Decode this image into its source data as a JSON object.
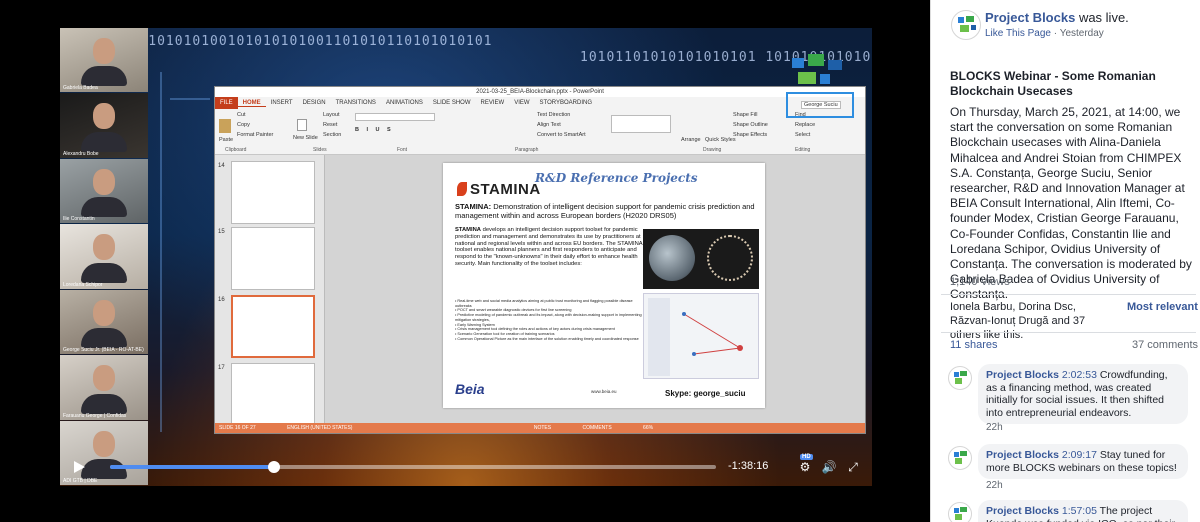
{
  "video": {
    "binary_top": "0101010110101010100101010101001101010110101010101",
    "binary_mid": "10101101010101010101 1010101010101010110101010",
    "participants": [
      {
        "name": "Gabriela Badea"
      },
      {
        "name": "Alexandru Bobe"
      },
      {
        "name": "Ilie Constantin"
      },
      {
        "name": "Loredana Schipor"
      },
      {
        "name": "George Suciu Jr. (BEIA - RO-AT-BE)"
      },
      {
        "name": "Farauanu George | Confidas"
      },
      {
        "name": "ADI GTB | DBE"
      }
    ],
    "ppt": {
      "title": "2021-03-25_BEIA-Blockchain.pptx - PowerPoint",
      "tabs": [
        "FILE",
        "HOME",
        "INSERT",
        "DESIGN",
        "TRANSITIONS",
        "ANIMATIONS",
        "SLIDE SHOW",
        "REVIEW",
        "VIEW",
        "STORYBOARDING"
      ],
      "ribbon": {
        "paste": "Paste",
        "cut": "Cut",
        "copy": "Copy",
        "format_painter": "Format Painter",
        "new_slide": "New Slide",
        "layout": "Layout",
        "reset": "Reset",
        "section": "Section",
        "text_direction": "Text Direction",
        "align_text": "Align Text",
        "convert_smartart": "Convert to SmartArt",
        "arrange": "Arrange",
        "quick_styles": "Quick Styles",
        "shape_fill": "Shape Fill",
        "shape_outline": "Shape Outline",
        "shape_effects": "Shape Effects",
        "find": "Find",
        "replace": "Replace",
        "select": "Select",
        "user": "George Suciu",
        "groups": [
          "Clipboard",
          "Slides",
          "Font",
          "Paragraph",
          "Drawing",
          "Editing"
        ]
      },
      "thumb_numbers": [
        "14",
        "15",
        "16",
        "17"
      ],
      "slide": {
        "heading": "R&D Reference Projects",
        "logo": "STAMINA",
        "subtitle_bold": "STAMINA:",
        "subtitle": "Demonstration of intelligent decision support for pandemic crisis prediction and management within and across European borders (H2020 DRS05)",
        "body_bold": "STAMINA",
        "body": "develops an intelligent decision support toolset for pandemic prediction and management and demonstrates its use by practitioners at national and regional levels within and across EU borders. The STAMINA toolset enables national planners and first responders to anticipate and respond to the \"known-unknowns\" in their daily effort to enhance health security. Main functionality of the toolset includes:",
        "bullets": [
          "Real-time web and social media analytics aiming at public trust monitoring and flagging possible disease outbreaks",
          "POCT and smart wearable diagnostic devices for first line screening",
          "Predictive modeling of pandemic outbreak and its impact, along with decision-making support in implementing",
          "mitigation strategies,",
          "Early Warning System",
          "Crisis management tool defining the roles and actions of key actors during crisis management",
          "Scenario Generation tool for creation of training scenarios",
          "Common Operational Picture as the main interface of the solution enabling timely and coordinated response"
        ],
        "footer_logo": "Beia",
        "url": "www.beia.eu",
        "skype": "Skype: george_suciu"
      },
      "status": {
        "slide_of": "SLIDE 16 OF 27",
        "language": "ENGLISH (UNITED STATES)",
        "notes": "NOTES",
        "comments": "COMMENTS",
        "zoom": "66%"
      }
    },
    "controls": {
      "time_remaining": "-1:38:16",
      "hd_label": "HD",
      "progress": 0.27
    }
  },
  "sidebar": {
    "page_name": "Project Blocks",
    "live_text": " was live.",
    "like_page": "Like This Page",
    "separator": " · ",
    "timestamp": "Yesterday",
    "post_title": "BLOCKS Webinar - Some Romanian Blockchain Usecases",
    "post_body": "On Thursday, March 25, 2021, at 14:00, we start the conversation on some Romanian Blockchain usecases with Alina-Daniela Mihalcea and Andrei Stoian from CHIMPEX S.A. Constanța, George Suciu, Senior researcher, R&D and Innovation Manager at BEIA Consult International, Alin Iftemi, Co-founder Modex, Cristian George Farauanu, Co-Founder Confidas, Constantin Ilie and Loredana Schipor, Ovidius University of Constanța. The conversation is moderated by Gabriela Badea of Ovidius University of Constanța.",
    "views": "1,140 Views",
    "likes_text": "Ionela Barbu, Dorina Dsc, Răzvan-Ionuț Drugă and 37 others like this.",
    "most_relevant": "Most relevant",
    "shares": "11 shares",
    "comments_count": "37 comments",
    "comments": [
      {
        "author": "Project Blocks",
        "timestamp": "2:02:53",
        "text": "Crowdfunding, as a financing method, was created initially for social issues. It then shifted into entrepreneurial endeavors.",
        "age": "22h"
      },
      {
        "author": "Project Blocks",
        "timestamp": "2:09:17",
        "text": "Stay tuned for more BLOCKS webinars on these topics!",
        "age": "22h"
      },
      {
        "author": "Project Blocks",
        "timestamp": "1:57:05",
        "text": "The project Kuende was funded via ICO, as per their",
        "age": ""
      }
    ],
    "logo_colors": [
      "#3aa84a",
      "#2a7fd4",
      "#6cc04a",
      "#1e5fa8"
    ]
  }
}
